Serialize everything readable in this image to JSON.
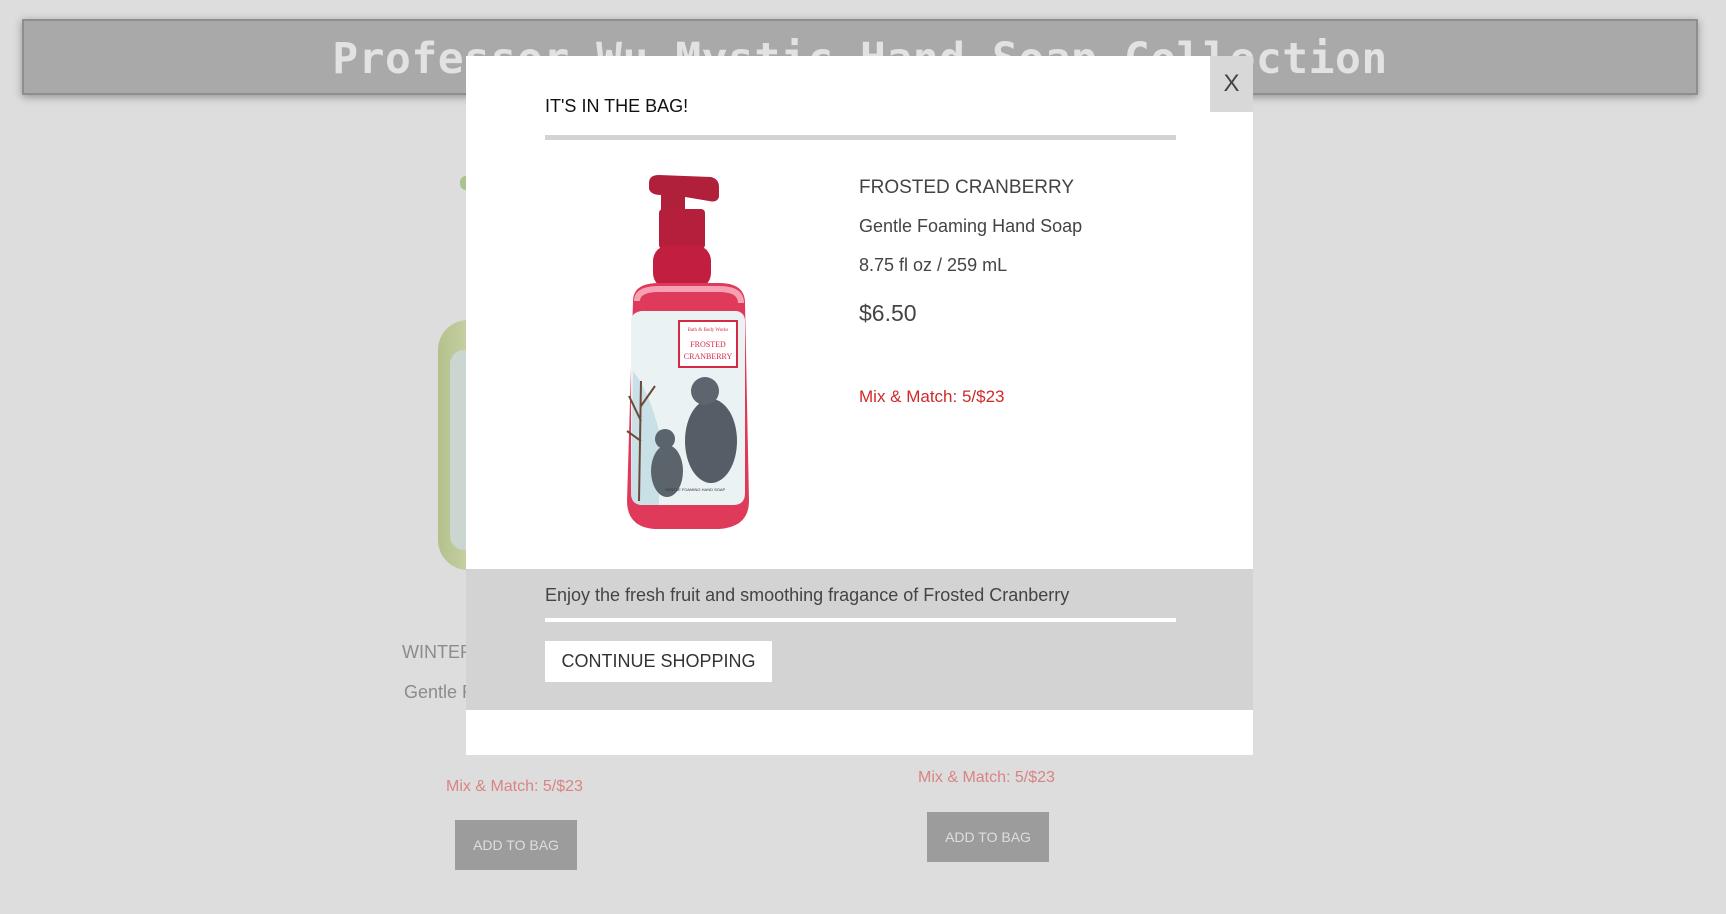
{
  "page": {
    "header_title": "Professor Wu Mystic Hand Soap Collection",
    "left_product": {
      "name": "WINTER",
      "subtitle": "Gentle F",
      "promo": "Mix & Match: 5/$23",
      "add_to_bag": "ADD TO BAG"
    },
    "right_product": {
      "promo": "Mix & Match: 5/$23",
      "add_to_bag": "ADD TO BAG"
    }
  },
  "modal": {
    "title": "IT'S IN THE BAG!",
    "close_label": "X",
    "product": {
      "name": "FROSTED CRANBERRY",
      "type": "Gentle Foaming Hand Soap",
      "size": "8.75 fl oz / 259 mL",
      "price": "$6.50",
      "promo": "Mix & Match: 5/$23",
      "label_brand": "Bath & Body Works",
      "label_title_line1": "FROSTED",
      "label_title_line2": "CRANBERRY",
      "label_bottom": "GENTLE FOAMING HAND SOAP"
    },
    "description": "Enjoy the fresh fruit and smoothing fragance of Frosted Cranberry",
    "continue_label": "CONTINUE SHOPPING"
  },
  "colors": {
    "overlay_background": "#dddddd",
    "header_background": "#a9a9a9",
    "promo_red": "#cf2a2a",
    "footer_gray": "#d3d3d3",
    "pump_red": "#b0203a"
  }
}
